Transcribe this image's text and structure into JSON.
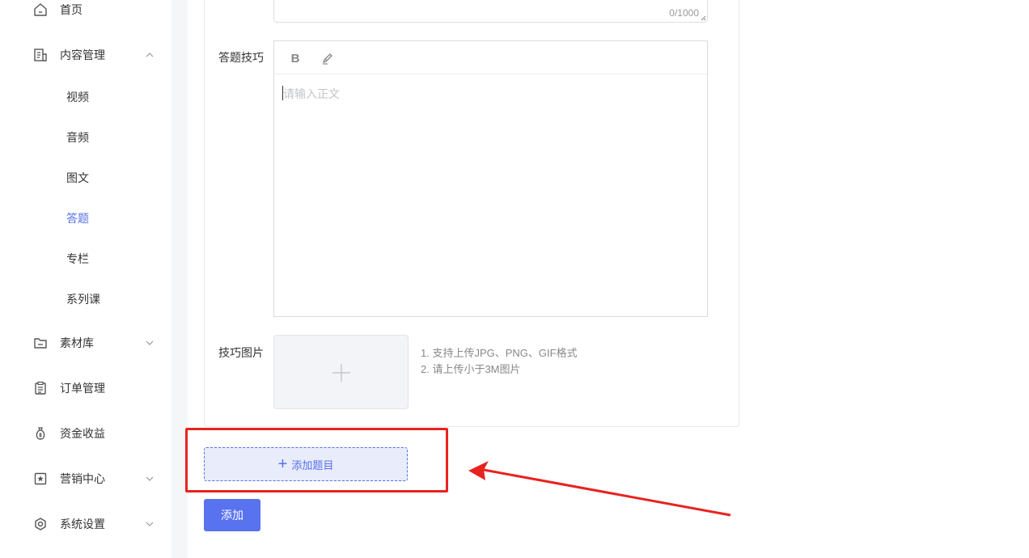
{
  "sidebar": {
    "items": [
      {
        "label": "首页",
        "icon": "home-icon"
      },
      {
        "label": "内容管理",
        "icon": "document-icon",
        "expanded": true
      },
      {
        "label": "素材库",
        "icon": "folder-icon"
      },
      {
        "label": "订单管理",
        "icon": "clipboard-icon"
      },
      {
        "label": "资金收益",
        "icon": "money-bag-icon"
      },
      {
        "label": "营销中心",
        "icon": "star-badge-icon"
      },
      {
        "label": "系统设置",
        "icon": "settings-icon"
      }
    ],
    "content_subitems": [
      {
        "label": "视频"
      },
      {
        "label": "音频"
      },
      {
        "label": "图文"
      },
      {
        "label": "答题",
        "active": true
      },
      {
        "label": "专栏"
      },
      {
        "label": "系列课"
      }
    ]
  },
  "form": {
    "textarea_counter": "0/1000",
    "tips_label": "答题技巧",
    "editor_placeholder": "请输入正文",
    "editor_toolbar": {
      "bold": "B",
      "highlight_icon": "highlighter-icon"
    },
    "image_label": "技巧图片",
    "upload_hint_1": "1. 支持上传JPG、PNG、GIF格式",
    "upload_hint_2": "2. 请上传小于3M图片",
    "add_question_label": "添加题目",
    "submit_label": "添加"
  },
  "colors": {
    "accent": "#5570ee",
    "annotation_red": "#e8231f"
  }
}
